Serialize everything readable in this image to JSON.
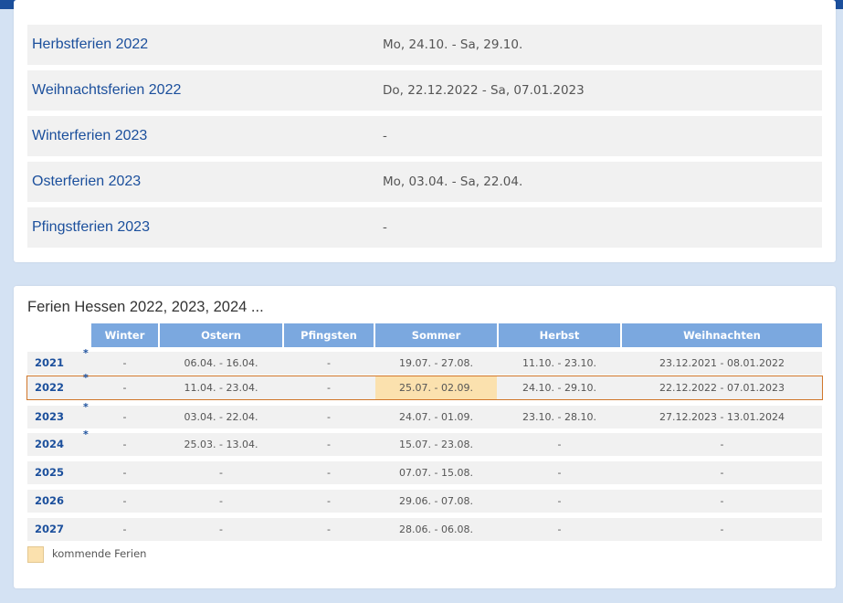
{
  "holidays": [
    {
      "name": "Herbstferien 2022",
      "dates": "Mo, 24.10. - Sa, 29.10."
    },
    {
      "name": "Weihnachtsferien 2022",
      "dates": "Do, 22.12.2022 - Sa, 07.01.2023"
    },
    {
      "name": "Winterferien 2023",
      "dates": "-"
    },
    {
      "name": "Osterferien 2023",
      "dates": "Mo, 03.04. - Sa, 22.04."
    },
    {
      "name": "Pfingstferien 2023",
      "dates": "-"
    }
  ],
  "table": {
    "title": "Ferien Hessen 2022, 2023, 2024 ...",
    "headers": [
      "Winter",
      "Ostern",
      "Pfingsten",
      "Sommer",
      "Herbst",
      "Weihnachten"
    ],
    "rows": [
      {
        "year": "2021",
        "star": "*",
        "cells": [
          "-",
          "06.04. - 16.04.",
          "-",
          "19.07. - 27.08.",
          "11.10. - 23.10.",
          "23.12.2021 - 08.01.2022"
        ]
      },
      {
        "year": "2022",
        "star": "*",
        "cells": [
          "-",
          "11.04. - 23.04.",
          "-",
          "25.07. - 02.09.",
          "24.10. - 29.10.",
          "22.12.2022 - 07.01.2023"
        ]
      },
      {
        "year": "2023",
        "star": "*",
        "cells": [
          "-",
          "03.04. - 22.04.",
          "-",
          "24.07. - 01.09.",
          "23.10. - 28.10.",
          "27.12.2023 - 13.01.2024"
        ]
      },
      {
        "year": "2024",
        "star": "*",
        "cells": [
          "-",
          "25.03. - 13.04.",
          "-",
          "15.07. - 23.08.",
          "-",
          "-"
        ]
      },
      {
        "year": "2025",
        "star": "",
        "cells": [
          "-",
          "-",
          "-",
          "07.07. - 15.08.",
          "-",
          "-"
        ]
      },
      {
        "year": "2026",
        "star": "",
        "cells": [
          "-",
          "-",
          "-",
          "29.06. - 07.08.",
          "-",
          "-"
        ]
      },
      {
        "year": "2027",
        "star": "",
        "cells": [
          "-",
          "-",
          "-",
          "28.06. - 06.08.",
          "-",
          "-"
        ]
      }
    ]
  },
  "legend": {
    "label": "kommende Ferien",
    "color": "#fbe1ae"
  },
  "colors": {
    "accent": "#1b4f9c",
    "header": "#7ba8df",
    "selected_border": "#d0762a"
  }
}
